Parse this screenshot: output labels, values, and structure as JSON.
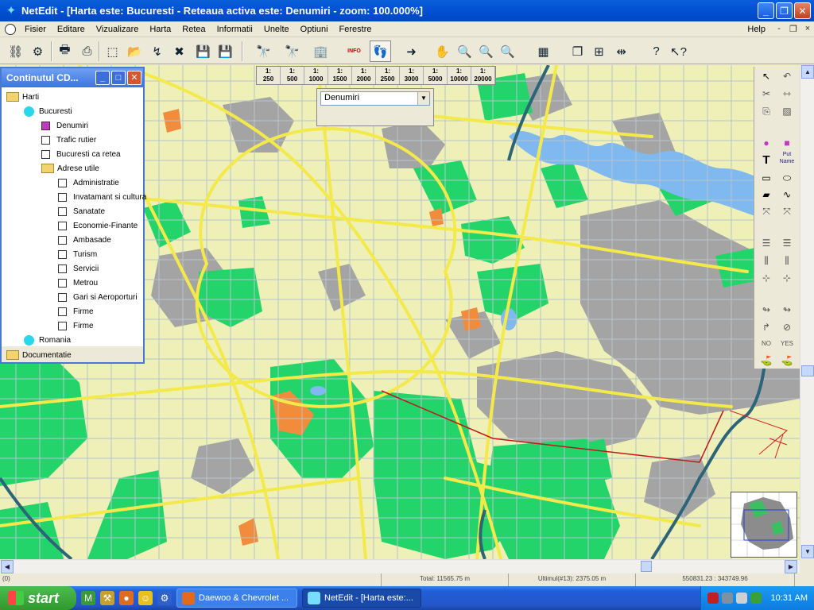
{
  "window": {
    "title": "NetEdit - [Harta este:  Bucuresti - Reteaua activa este:  Denumiri  - zoom: 100.000%]",
    "controls": {
      "minimize": "_",
      "restore": "❐",
      "close": "✕"
    }
  },
  "menu": {
    "items": [
      "Fisier",
      "Editare",
      "Vizualizare",
      "Harta",
      "Retea",
      "Informatii",
      "Unelte",
      "Optiuni",
      "Ferestre"
    ],
    "help": "Help",
    "mdi": {
      "minimize": "-",
      "restore": "❐",
      "close": "×"
    }
  },
  "toolbar": {
    "info_label": "INFO",
    "active_tool": "layer-pick"
  },
  "scales": [
    {
      "top": "1:",
      "bottom": "250"
    },
    {
      "top": "1:",
      "bottom": "500"
    },
    {
      "top": "1:",
      "bottom": "1000"
    },
    {
      "top": "1:",
      "bottom": "1500"
    },
    {
      "top": "1:",
      "bottom": "2000"
    },
    {
      "top": "1:",
      "bottom": "2500"
    },
    {
      "top": "1:",
      "bottom": "3000"
    },
    {
      "top": "1:",
      "bottom": "5000"
    },
    {
      "top": "1:",
      "bottom": "10000"
    },
    {
      "top": "1:",
      "bottom": "20000"
    }
  ],
  "layer_combo": {
    "selected": "Denumiri",
    "arrow": "▼"
  },
  "panel": {
    "title": "Continutul CD...",
    "tree": {
      "harti": "Harti",
      "bucuresti": "Bucuresti",
      "denumiri": "Denumiri",
      "trafic": "Trafic rutier",
      "retea": "Bucuresti ca retea",
      "adrese": "Adrese utile",
      "adrese_items": [
        "Administratie",
        "Invatamant si cultura",
        "Sanatate",
        "Economie-Finante",
        "Ambasade",
        "Turism",
        "Servicii",
        "Metrou",
        "Gari si Aeroporturi",
        "Firme",
        "Firme"
      ],
      "romania": "Romania",
      "documentatie": "Documentatie"
    }
  },
  "right_tools": {
    "text_tool": "T",
    "name_tool": "Put Name",
    "no_label": "NO",
    "yes_label": "YES"
  },
  "map": {
    "colors": {
      "background": "#f0f0b4",
      "park": "#22d46a",
      "road": "#f4e94a",
      "street": "#b8c4cc",
      "industrial": "#a0a0a0",
      "water": "#80b8f0",
      "orange": "#f08c3c",
      "railway": "#2c6478"
    }
  },
  "scrollbar": {
    "up": "▲",
    "down": "▼",
    "left": "◀",
    "right": "▶"
  },
  "status": {
    "s1": "(0)",
    "s2": "Total: 11565.75 m",
    "s3": "Ultimul(#13):  2375.05 m",
    "s4": "550831.23 : 343749.96"
  },
  "taskbar": {
    "start": "start",
    "tasks": [
      {
        "label": "Daewoo & Chevrolet ..."
      },
      {
        "label": "NetEdit - [Harta este:..."
      }
    ],
    "clock": "10:31 AM"
  }
}
